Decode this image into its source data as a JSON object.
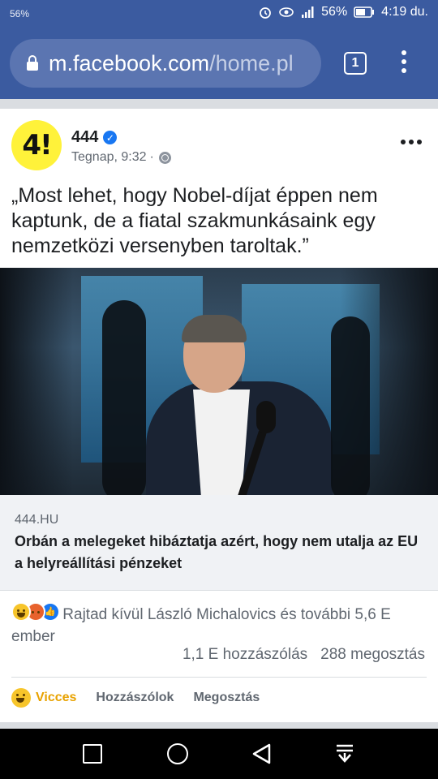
{
  "status": {
    "left": "56%",
    "battery": "56%",
    "time": "4:19 du."
  },
  "browser": {
    "url_main": "m.facebook.com",
    "url_path": "/home.pl",
    "tab_count": "1"
  },
  "post": {
    "page_name": "444",
    "time": "Tegnap, 9:32",
    "separator": "·",
    "text": "„Most lehet, hogy Nobel-díjat éppen nem kaptunk, de a fiatal szakmunkásaink egy nemzetközi versenyben taroltak.”",
    "avatar_text": "4!",
    "link": {
      "domain": "444.HU",
      "headline": "Orbán a melegeket hibáztatja azért, hogy nem utalja az EU a helyreállítási pénzeket"
    },
    "reactions_text": "Rajtad kívül László Michalovics és további 5,6 E ember",
    "comments": "1,1 E hozzászólás",
    "shares": "288 megosztás",
    "actions": {
      "haha": "Vicces",
      "comment": "Hozzászólok",
      "share": "Megosztás"
    }
  },
  "colors": {
    "header": "#3b5ba0",
    "haha": "#e8a200",
    "verified": "#1877f2"
  }
}
